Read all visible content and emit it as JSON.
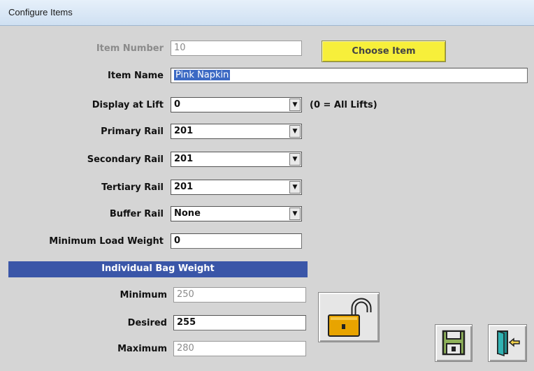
{
  "window": {
    "title": "Configure Items"
  },
  "item_number": {
    "label": "Item Number",
    "value": "10"
  },
  "choose_item": {
    "label": "Choose Item"
  },
  "item_name": {
    "label": "Item Name",
    "value": "Pink Napkin"
  },
  "display_at_lift": {
    "label": "Display at Lift",
    "value": "0",
    "hint": "(0 = All Lifts)"
  },
  "primary_rail": {
    "label": "Primary Rail",
    "value": "201"
  },
  "secondary_rail": {
    "label": "Secondary Rail",
    "value": "201"
  },
  "tertiary_rail": {
    "label": "Tertiary Rail",
    "value": "201"
  },
  "buffer_rail": {
    "label": "Buffer Rail",
    "value": "None"
  },
  "min_load_weight": {
    "label": "Minimum Load Weight",
    "value": "0"
  },
  "bag_weight": {
    "header": "Individual Bag Weight",
    "minimum": {
      "label": "Minimum",
      "value": "250"
    },
    "desired": {
      "label": "Desired",
      "value": "255"
    },
    "maximum": {
      "label": "Maximum",
      "value": "280"
    }
  },
  "icons": {
    "unlock": "unlock-icon",
    "save": "save-icon",
    "exit": "exit-door-icon",
    "dropdown": "chevron-down-icon"
  },
  "colors": {
    "choose_button": "#f7ef3a",
    "section_header": "#3a56a8",
    "lock_gold": "#e8a400",
    "save_green": "#8fb25a",
    "exit_teal": "#1f8c8c"
  }
}
